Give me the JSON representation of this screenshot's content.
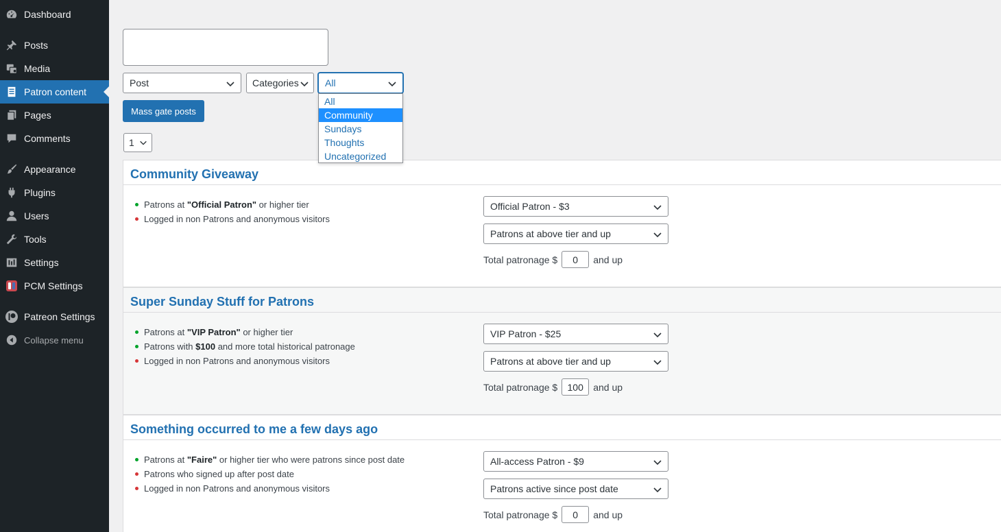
{
  "sidebar": {
    "items": [
      {
        "label": "Dashboard",
        "icon": "dashboard-icon"
      },
      {
        "label": "Posts",
        "icon": "pin-icon"
      },
      {
        "label": "Media",
        "icon": "media-icon"
      },
      {
        "label": "Patron content",
        "icon": "document-icon",
        "current": true
      },
      {
        "label": "Pages",
        "icon": "pages-icon"
      },
      {
        "label": "Comments",
        "icon": "comment-icon"
      },
      {
        "label": "Appearance",
        "icon": "brush-icon"
      },
      {
        "label": "Plugins",
        "icon": "plug-icon"
      },
      {
        "label": "Users",
        "icon": "user-icon"
      },
      {
        "label": "Tools",
        "icon": "wrench-icon"
      },
      {
        "label": "Settings",
        "icon": "settings-icon"
      },
      {
        "label": "PCM Settings",
        "icon": "pcm-logo-icon"
      },
      {
        "label": "Patreon Settings",
        "icon": "patreon-icon"
      },
      {
        "label": "Collapse menu",
        "icon": "collapse-icon"
      }
    ]
  },
  "filters": {
    "post_type": "Post",
    "taxonomy": "Categories",
    "term": "All",
    "term_options": [
      "All",
      "Community",
      "Sundays",
      "Thoughts",
      "Uncategorized"
    ],
    "highlighted_option": "Community"
  },
  "mass_gate_label": "Mass gate posts",
  "page_select": "1",
  "posts": [
    {
      "title": "Community Giveaway",
      "rules": [
        {
          "status": "allowed",
          "pre": "Patrons at ",
          "bold": "\"Official Patron\"",
          "post": " or higher tier"
        },
        {
          "status": "denied",
          "pre": "Logged in non Patrons and anonymous visitors",
          "bold": "",
          "post": ""
        }
      ],
      "tier": "Official Patron - $3",
      "scope": "Patrons at above tier and up",
      "total_label": "Total patronage $",
      "total_value": "0",
      "total_suffix": "and up"
    },
    {
      "title": "Super Sunday Stuff for Patrons",
      "rules": [
        {
          "status": "allowed",
          "pre": "Patrons at ",
          "bold": "\"VIP Patron\"",
          "post": " or higher tier"
        },
        {
          "status": "allowed",
          "pre": "Patrons with ",
          "bold": "$100",
          "post": " and more total historical patronage"
        },
        {
          "status": "denied",
          "pre": "Logged in non Patrons and anonymous visitors",
          "bold": "",
          "post": ""
        }
      ],
      "tier": "VIP Patron - $25",
      "scope": "Patrons at above tier and up",
      "total_label": "Total patronage $",
      "total_value": "100",
      "total_suffix": "and up"
    },
    {
      "title": "Something occurred to me a few days ago",
      "rules": [
        {
          "status": "allowed",
          "pre": "Patrons at ",
          "bold": "\"Faire\"",
          "post": " or higher tier who were patrons since post date"
        },
        {
          "status": "denied",
          "pre": "Patrons who signed up after post date",
          "bold": "",
          "post": ""
        },
        {
          "status": "denied",
          "pre": "Logged in non Patrons and anonymous visitors",
          "bold": "",
          "post": ""
        }
      ],
      "tier": "All-access Patron - $9",
      "scope": "Patrons active since post date",
      "total_label": "Total patronage $",
      "total_value": "0",
      "total_suffix": "and up"
    }
  ],
  "colors": {
    "sidebar_bg": "#1d2327",
    "accent": "#2271b1",
    "allowed": "#00a32a",
    "denied": "#d63638",
    "dropdown_highlight": "#1e90ff"
  }
}
